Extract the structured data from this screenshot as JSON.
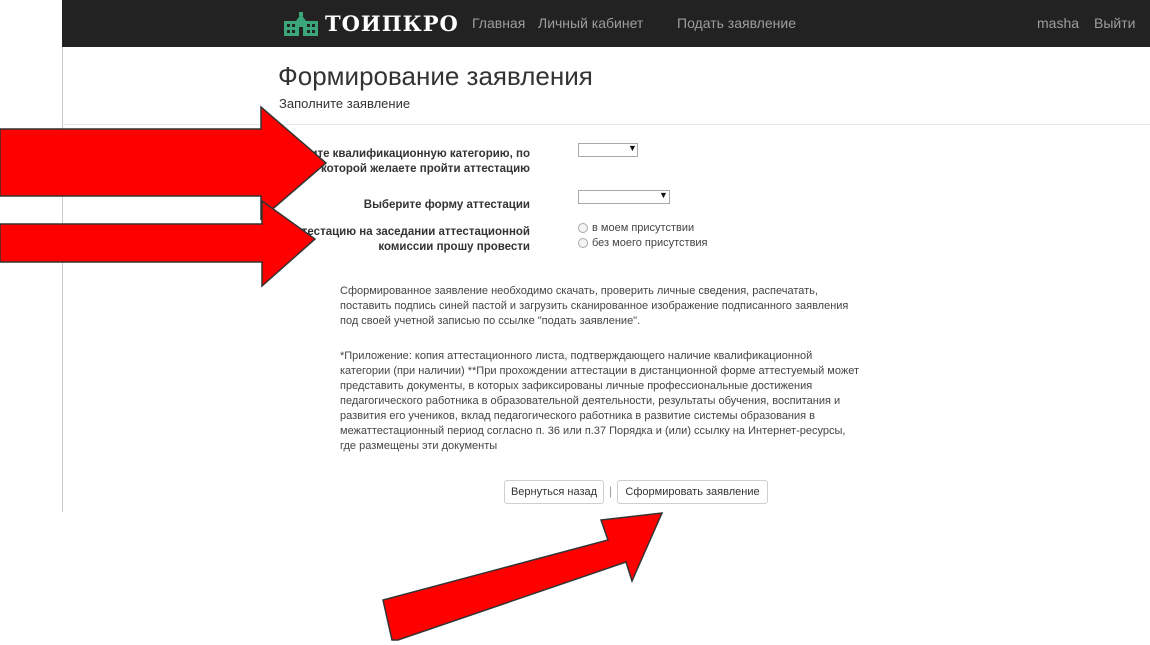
{
  "navbar": {
    "brand": "ТОИПКРО",
    "links": [
      "Главная",
      "Личный кабинет",
      "Подать заявление"
    ],
    "user": "masha",
    "logout": "Выйти"
  },
  "page": {
    "title": "Формирование заявления",
    "subtitle": "Заполните заявление"
  },
  "form": {
    "category_label_line1": "Укажите квалификационную категорию, по",
    "category_label_line2": "которой желаете пройти аттестацию",
    "category_value": "",
    "form_label": "Выберите форму аттестации",
    "form_value": "",
    "presence_label_line1": "Аттестацию на заседании аттестационной",
    "presence_label_line2": "комиссии прошу провести",
    "presence_options": [
      "в моем присутствии",
      "без моего присутствия"
    ]
  },
  "notes": {
    "instruction": "Сформированное заявление необходимо скачать, проверить личные сведения, распечатать, поставить подпись синей пастой и загрузить сканированное изображение подписанного заявления под своей учетной записью по ссылке \"подать заявление\".",
    "appendix": "*Приложение: копия аттестационного листа, подтверждающего наличие квалификационной категории (при наличии) **При прохождении аттестации в дистанционной форме аттестуемый может представить документы, в которых зафиксированы личные профессиональные достижения педагогического работника в образовательной деятельности, результаты обучения, воспитания и развития его учеников, вклад педагогического работника в развитие системы образования в межаттестационный период согласно п. 36 или п.37 Порядка и (или) ссылку на Интернет-ресурсы, где размещены эти документы"
  },
  "buttons": {
    "back": "Вернуться назад",
    "separator": "|",
    "generate": "Сформировать заявление"
  },
  "colors": {
    "navbar_bg": "#222222",
    "brand_icon": "#3aa67a",
    "annotation_arrow": "#ff0000"
  },
  "icons": {
    "brand": "building-icon",
    "select_arrow": "dropdown-arrow-icon"
  }
}
